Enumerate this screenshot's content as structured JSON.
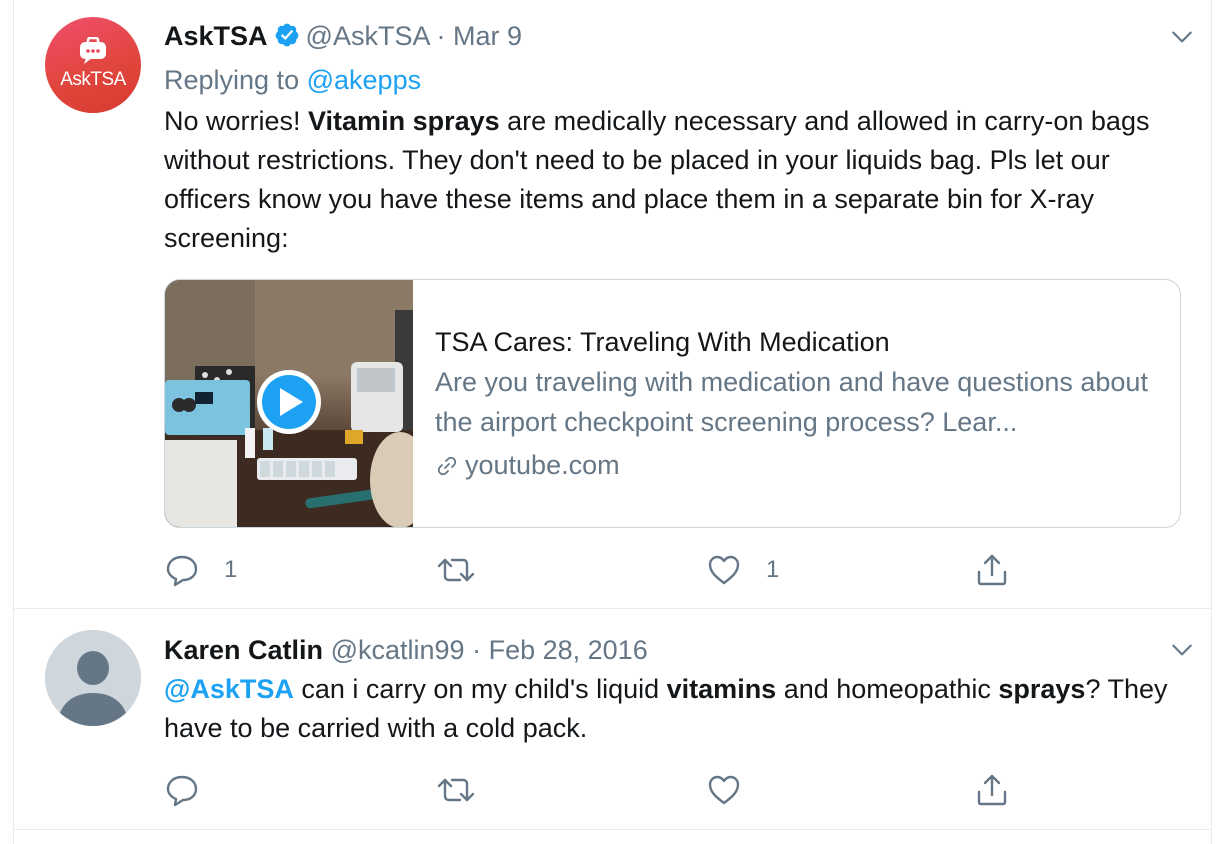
{
  "tweets": [
    {
      "avatar_text": "AskTSA",
      "name": "AskTSA",
      "handle": "@AskTSA",
      "separator": "·",
      "date": "Mar 9",
      "replying_prefix": "Replying to",
      "replying_handle": "@akepps",
      "text": {
        "p1": "No worries! ",
        "b1": "Vitamin sprays",
        "p2": " are medically necessary and allowed in carry-on bags without restrictions. They don't need to be placed in your liquids bag. Pls let our officers know you have these items and place them in a separate bin for X-ray screening:"
      },
      "card": {
        "title": "TSA Cares: Traveling With Medication",
        "description": "Are you traveling with medication and have questions about the airport checkpoint screening process? Lear...",
        "domain": "youtube.com"
      },
      "actions": {
        "reply_count": "1",
        "retweet_count": "",
        "like_count": "1"
      }
    },
    {
      "name": "Karen Catlin",
      "handle": "@kcatlin99",
      "separator": "·",
      "date": "Feb 28, 2016",
      "text": {
        "mention": "@AskTSA",
        "p1": " can i carry on my child's liquid ",
        "b1": "vitamins",
        "p2": " and homeopathic ",
        "b2": "sprays",
        "p3": "? They have to be carried with a cold pack."
      },
      "actions": {
        "reply_count": "",
        "retweet_count": "",
        "like_count": ""
      }
    }
  ],
  "colors": {
    "accent": "#1da1f2",
    "secondary_text": "#657786",
    "primary_text": "#14171a",
    "border": "#e6ecf0"
  }
}
